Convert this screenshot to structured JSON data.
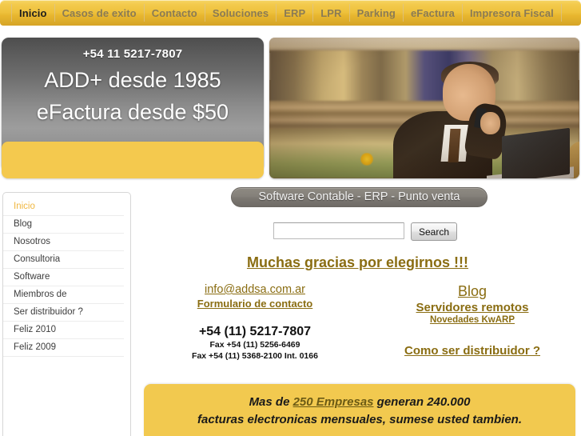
{
  "nav": {
    "items": [
      {
        "label": "Inicio",
        "active": true
      },
      {
        "label": "Casos de exito",
        "active": false
      },
      {
        "label": "Contacto",
        "active": false
      },
      {
        "label": "Soluciones",
        "active": false
      },
      {
        "label": "ERP",
        "active": false
      },
      {
        "label": "LPR",
        "active": false
      },
      {
        "label": "Parking",
        "active": false
      },
      {
        "label": "eFactura",
        "active": false
      },
      {
        "label": "Impresora Fiscal",
        "active": false
      }
    ]
  },
  "hero": {
    "phone": "+54 11 5217-7807",
    "line1": "ADD+ desde 1985",
    "line2": "eFactura desde $50",
    "photo_alt": "businessman-on-phone-with-laptop"
  },
  "sidebar": {
    "items": [
      {
        "label": "Inicio",
        "current": true
      },
      {
        "label": "Blog",
        "current": false
      },
      {
        "label": "Nosotros",
        "current": false
      },
      {
        "label": "Consultoria",
        "current": false
      },
      {
        "label": "Software",
        "current": false
      },
      {
        "label": "Miembros de",
        "current": false
      },
      {
        "label": "Ser distribuidor ?",
        "current": false
      },
      {
        "label": "Feliz 2010",
        "current": false
      },
      {
        "label": "Feliz 2009",
        "current": false
      }
    ]
  },
  "main": {
    "title_pill": "Software Contable - ERP - Punto venta",
    "search": {
      "value": "",
      "placeholder": "",
      "button_label": "Search"
    },
    "heading": "Muchas gracias por elegirnos !!!",
    "contact": {
      "email": "info@addsa.com.ar",
      "form_link": "Formulario de contacto",
      "phone": "+54 (11) 5217-7807",
      "fax1": "Fax +54 (11) 5256-6469",
      "fax2": "Fax +54 (11) 5368-2100 Int. 0166"
    },
    "links": {
      "blog": "Blog",
      "servidores": "Servidores remotos",
      "novedades": "Novedades KwARP",
      "distribuidor": "Como ser distribuidor ?"
    }
  },
  "promo": {
    "prefix": "Mas de ",
    "empresas": "250 Empresas",
    "middle": " generan ",
    "count": "240.000",
    "line2": "facturas electronicas mensuales, sumese usted tambien."
  },
  "colors": {
    "nav_gold": "#eec13c",
    "accent_brown": "#8a6d12",
    "panel_yellow": "#f2c94f",
    "grey_banner": "#8d8d8d",
    "pill_grey": "#7f7b75"
  }
}
